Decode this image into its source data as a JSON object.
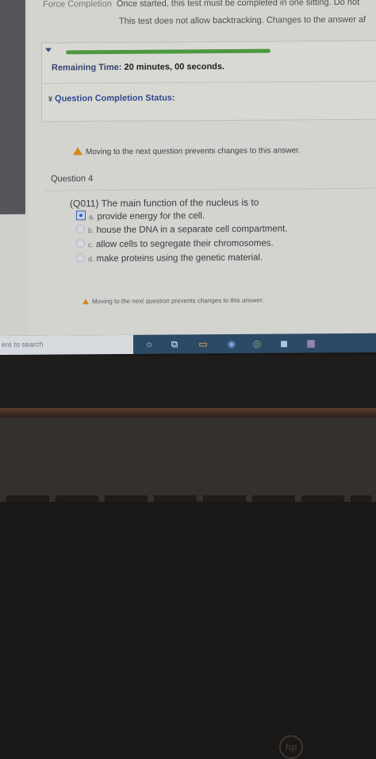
{
  "header": {
    "force_completion_label": "Force Completion",
    "force_completion_text": "Once started, this test must be completed in one sitting. Do not",
    "backtracking_text": "This test does not allow backtracking. Changes to the answer af"
  },
  "timer": {
    "progress_fraction": 1.0,
    "label": "Remaining Time:",
    "value": "20 minutes, 00 seconds."
  },
  "completion_status": {
    "label": "Question Completion Status:"
  },
  "warning_text": "Moving to the next question prevents changes to this answer.",
  "question": {
    "title": "Question 4",
    "text": "(Q011) The main function of the nucleus is to",
    "options": [
      {
        "letter": "a.",
        "text": "provide energy for the cell."
      },
      {
        "letter": "b.",
        "text": "house the DNA in a separate cell compartment."
      },
      {
        "letter": "c.",
        "text": "allow cells to segregate their chromosomes."
      },
      {
        "letter": "d.",
        "text": "make proteins using the genetic material."
      }
    ]
  },
  "taskbar": {
    "search_text": "ere to search"
  },
  "colors": {
    "accent_blue": "#2f4a8f",
    "progress_green": "#4c9a3f",
    "warning_orange": "#d08a1e",
    "taskbar": "#2c4a66"
  }
}
